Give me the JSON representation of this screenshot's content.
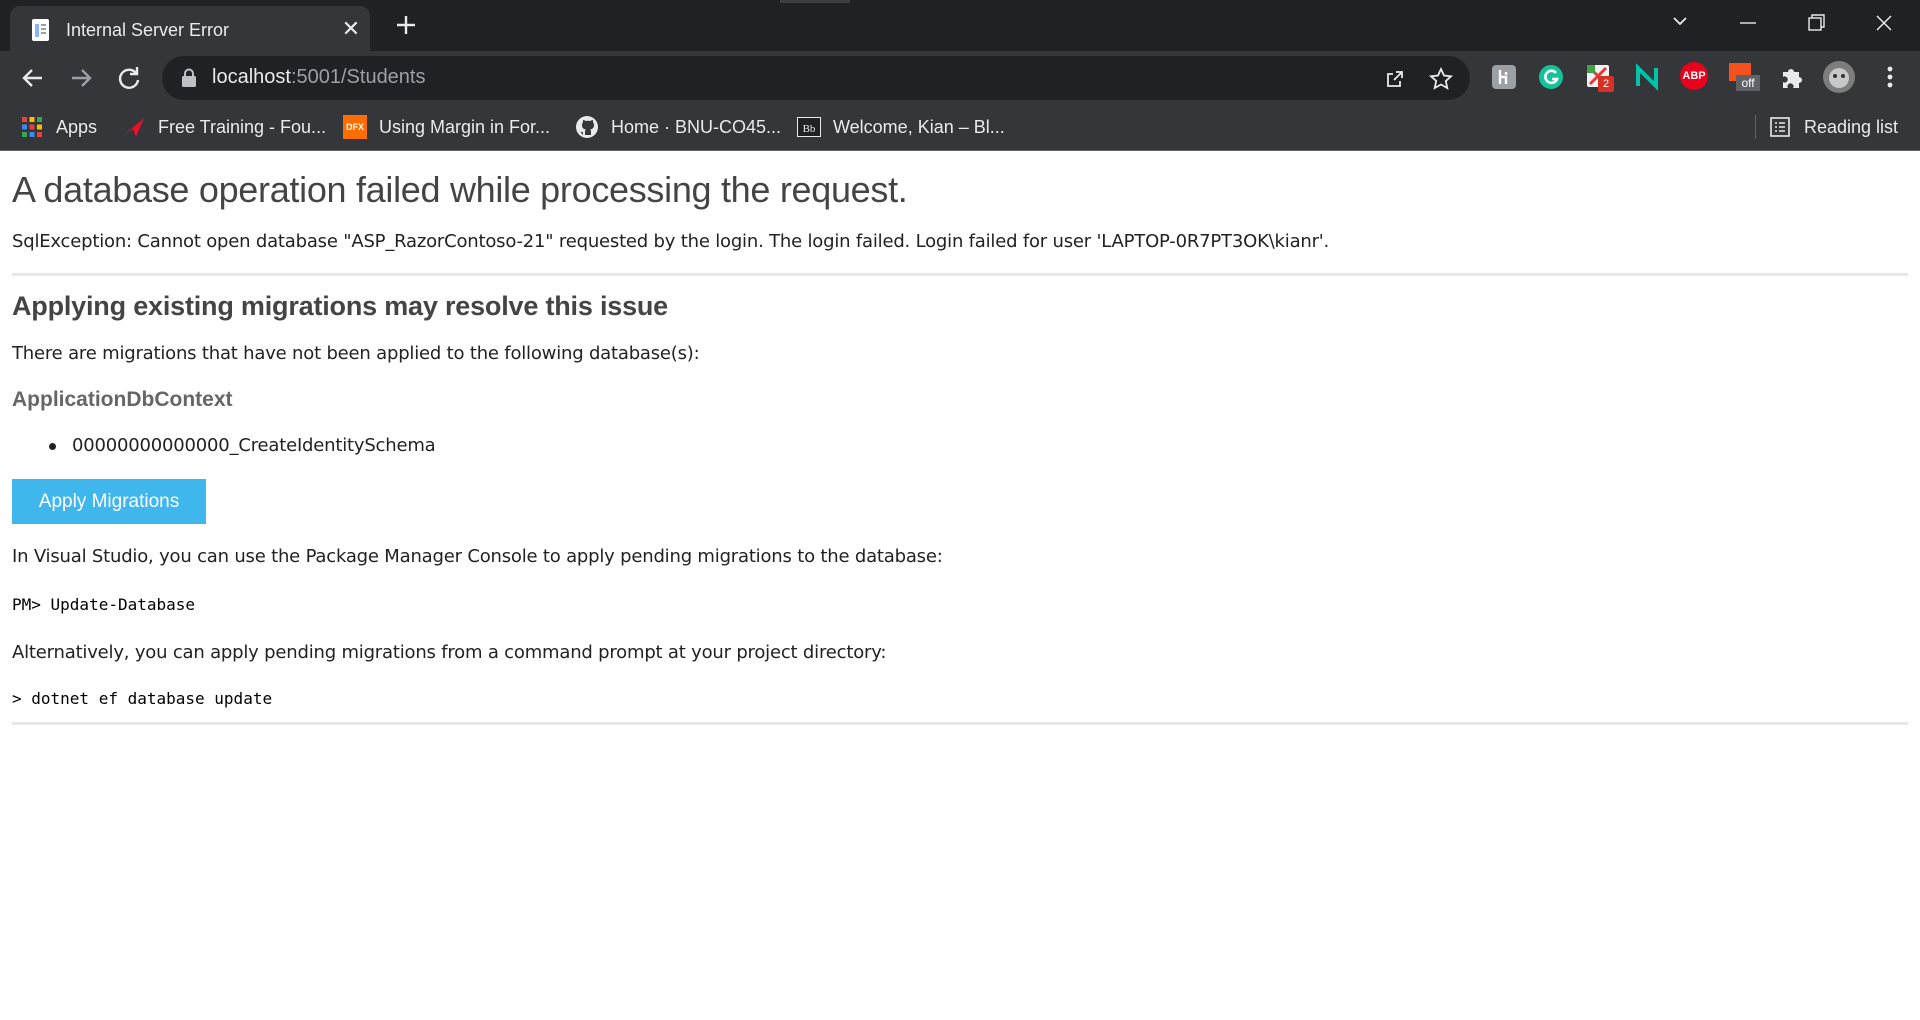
{
  "tab": {
    "title": "Internal Server Error",
    "close_glyph": "✕",
    "favicon": "page-icon"
  },
  "toolbar": {
    "url_host": "localhost",
    "url_rest": ":5001/Students",
    "extensions": [
      "grammarly-icon",
      "extension-badge-icon",
      "notion-icon",
      "adblock-icon",
      "coupon-off-icon",
      "puzzle-icon",
      "profile-avatar"
    ]
  },
  "extension_labels": {
    "badge_count": "2",
    "abp": "ABP",
    "off": "off"
  },
  "bookmarks": [
    {
      "label": "Apps",
      "icon": "apps-grid-icon"
    },
    {
      "label": "Free Training - Fou...",
      "icon": "red-arrow-icon"
    },
    {
      "label": "Using Margin in For...",
      "icon": "dfx-icon"
    },
    {
      "label": "Home · BNU-CO45...",
      "icon": "github-icon"
    },
    {
      "label": "Welcome, Kian – Bl...",
      "icon": "blackboard-icon"
    }
  ],
  "bookmark_icon_labels": {
    "dfx": "DFX",
    "bb": "Bb"
  },
  "reading_list": "Reading list",
  "page": {
    "title": "A database operation failed while processing the request.",
    "exception": "SqlException: Cannot open database \"ASP_RazorContoso-21\" requested by the login. The login failed. Login failed for user 'LAPTOP-0R7PT3OK\\kianr'.",
    "subheading": "Applying existing migrations may resolve this issue",
    "pending_text": "There are migrations that have not been applied to the following database(s):",
    "context_name": "ApplicationDbContext",
    "migrations": [
      "00000000000000_CreateIdentitySchema"
    ],
    "apply_button": "Apply Migrations",
    "vs_text": "In Visual Studio, you can use the Package Manager Console to apply pending migrations to the database:",
    "pm_command": "PM> Update-Database",
    "alt_text": "Alternatively, you can apply pending migrations from a command prompt at your project directory:",
    "cli_command": "> dotnet ef database update"
  },
  "colors": {
    "chrome_dark": "#202124",
    "chrome": "#35363a",
    "button": "#3fb6ec"
  }
}
